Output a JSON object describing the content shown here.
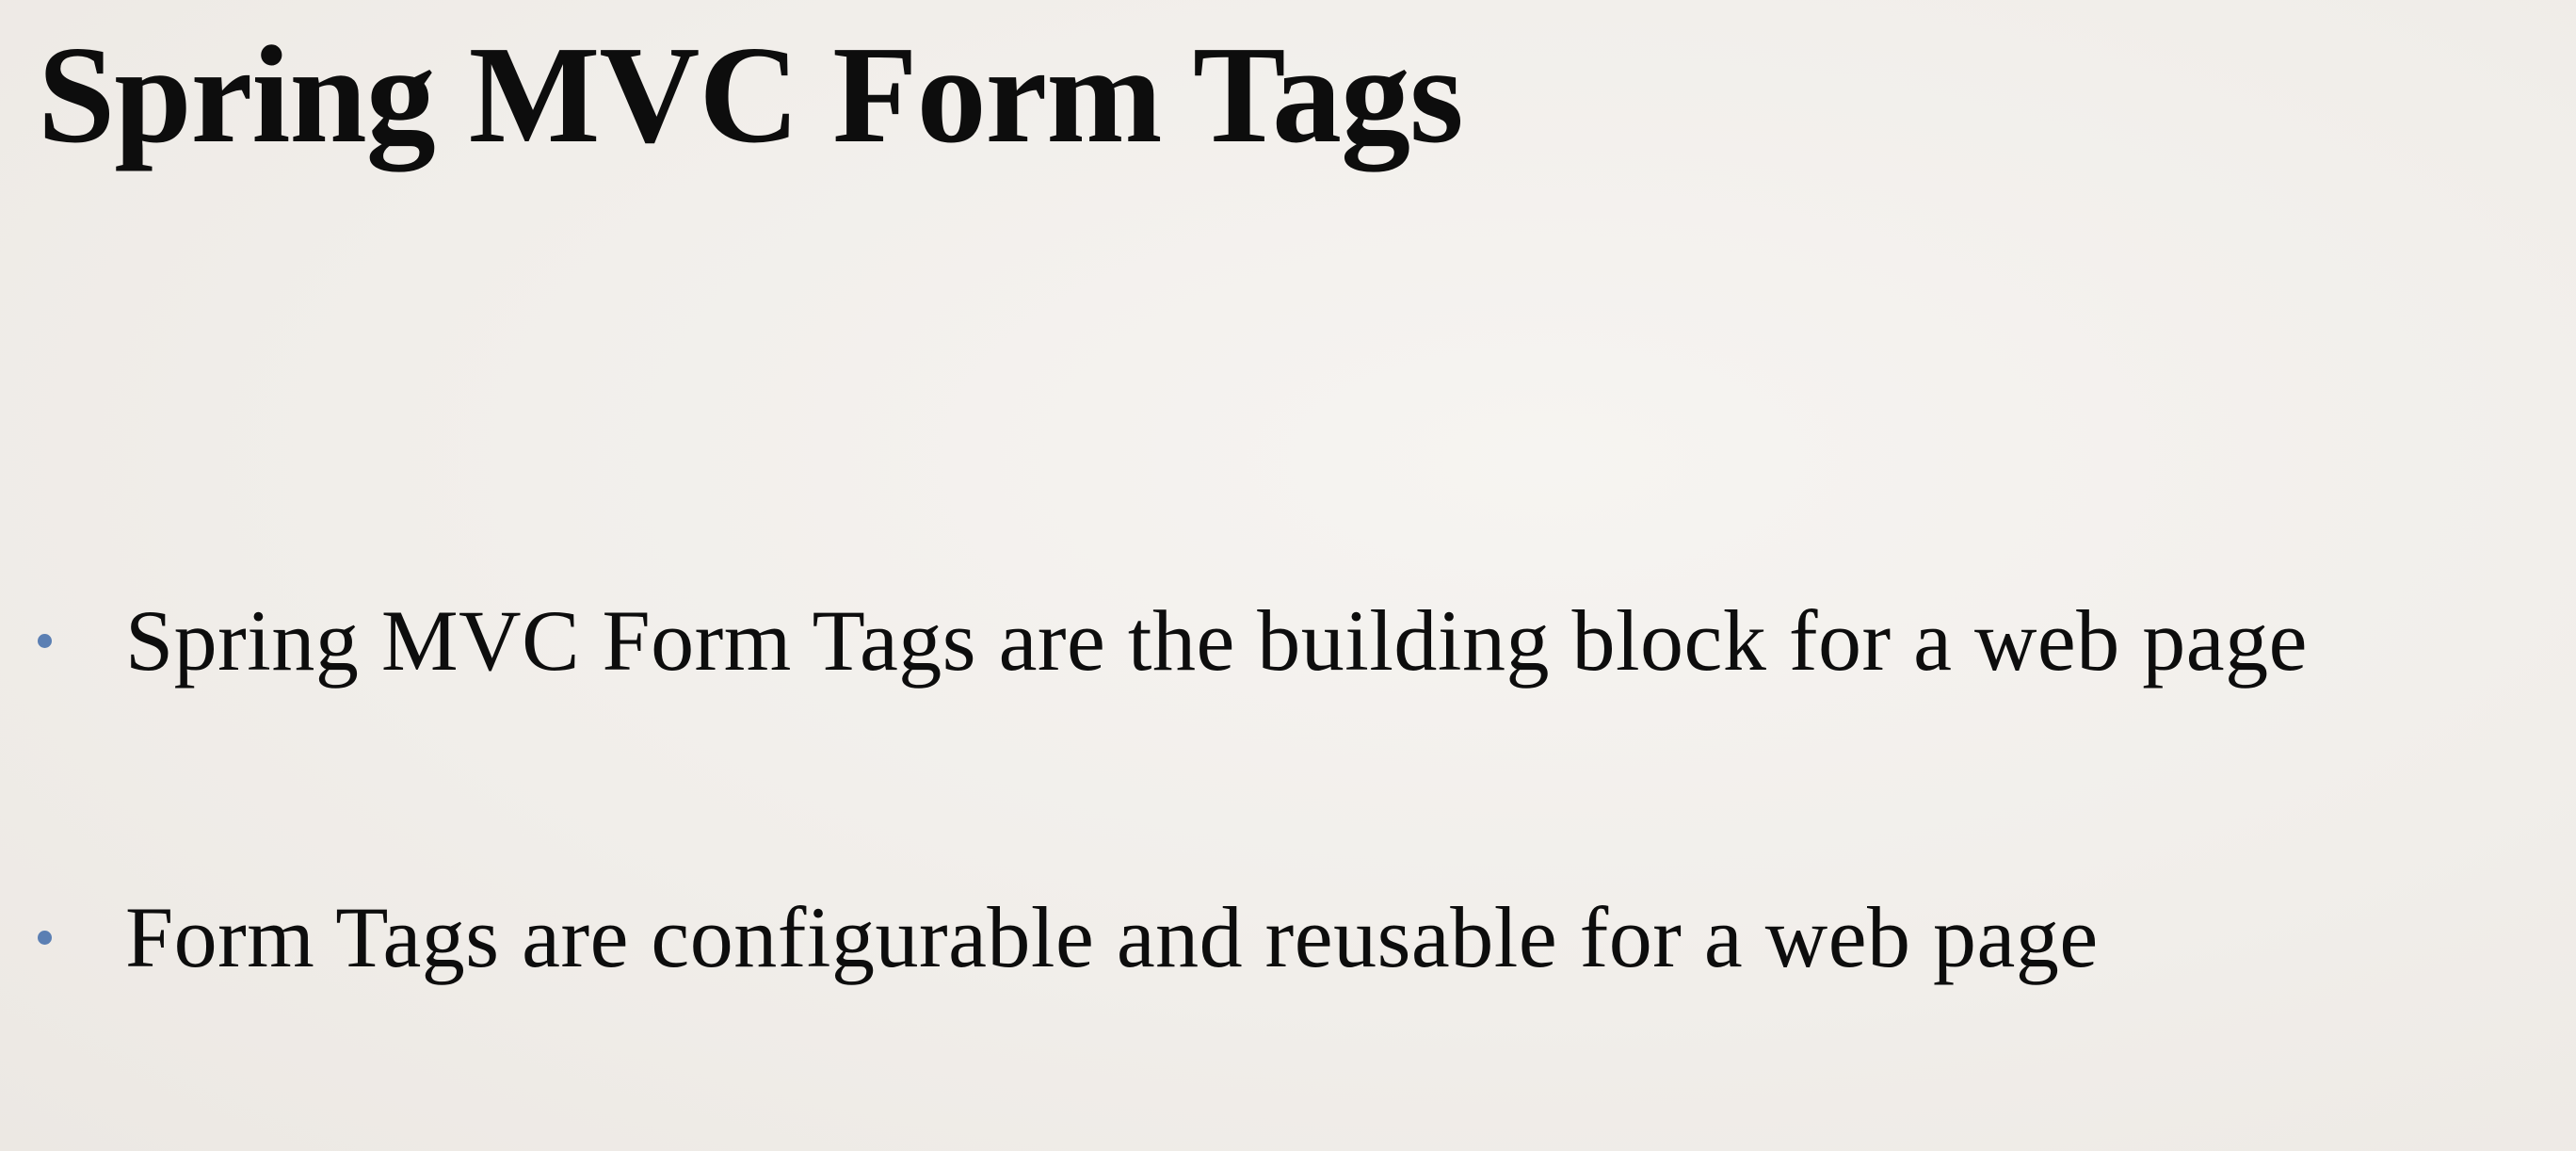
{
  "slide": {
    "title": "Spring MVC Form Tags",
    "bullets": [
      "Spring MVC Form Tags are the building block for a web page",
      "Form Tags are configurable and reusable for a web page"
    ],
    "bullet_icon": "bullet-dot-icon",
    "colors": {
      "background": "#f2efeb",
      "text": "#0d0d0d",
      "bullet": "#5b7fb3"
    }
  }
}
